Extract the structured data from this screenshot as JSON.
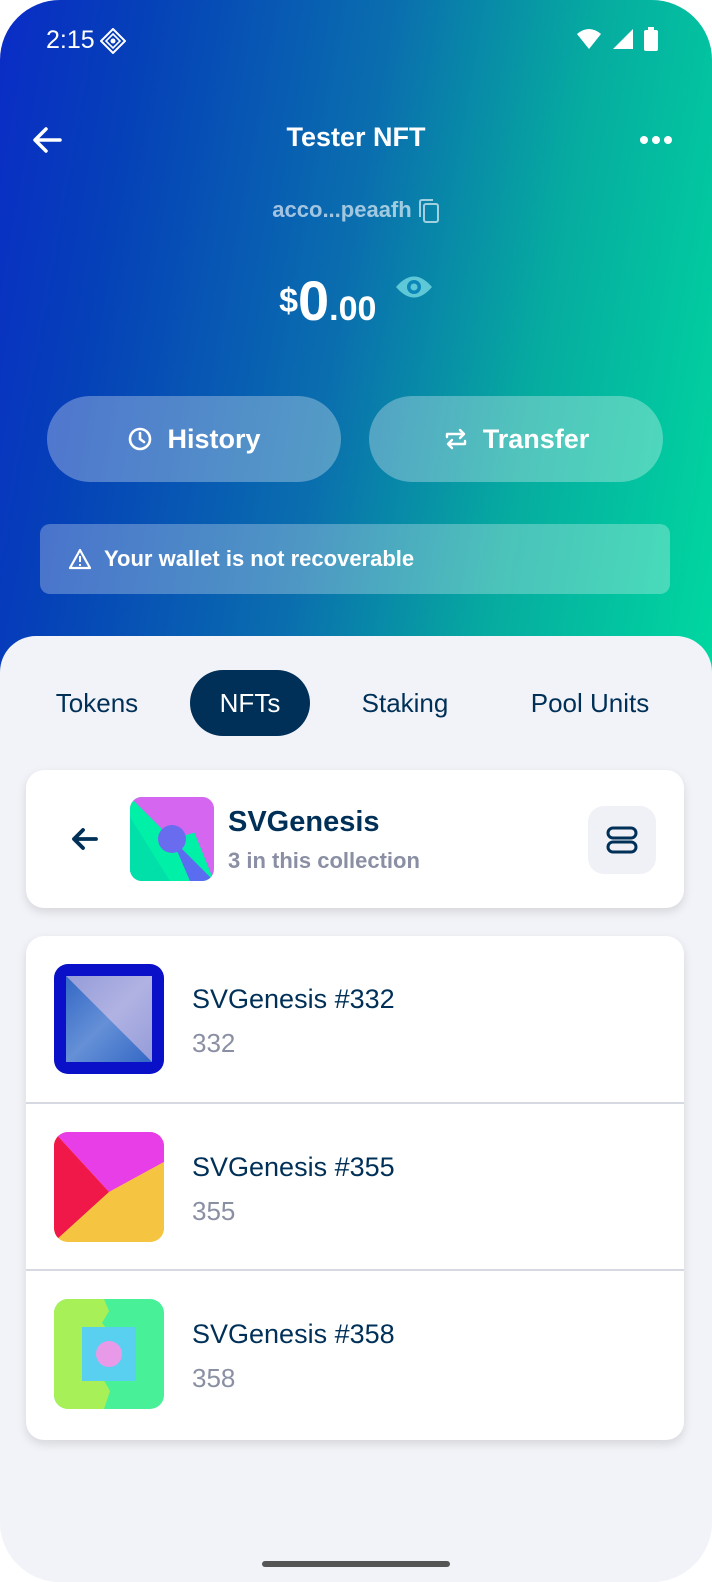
{
  "status_bar": {
    "time": "2:15"
  },
  "header": {
    "title": "Tester NFT",
    "address": "acco...peaafh"
  },
  "balance": {
    "currency": "$",
    "integer": "0",
    "decimal": ".00"
  },
  "actions": {
    "history_label": "History",
    "transfer_label": "Transfer"
  },
  "warning": {
    "text": "Your wallet is not recoverable"
  },
  "tabs": [
    {
      "label": "Tokens",
      "active": false
    },
    {
      "label": "NFTs",
      "active": true
    },
    {
      "label": "Staking",
      "active": false
    },
    {
      "label": "Pool Units",
      "active": false
    }
  ],
  "collection": {
    "name": "SVGenesis",
    "count_text": "3 in this collection"
  },
  "nfts": [
    {
      "name": "SVGenesis #332",
      "id": "332"
    },
    {
      "name": "SVGenesis #355",
      "id": "355"
    },
    {
      "name": "SVGenesis #358",
      "id": "358"
    }
  ],
  "colors": {
    "gradient_start": "#0a2cc6",
    "gradient_end": "#00d8a0",
    "primary_text": "#003057",
    "secondary_text": "#8a8fa4",
    "sheet_bg": "#f2f3f8"
  }
}
